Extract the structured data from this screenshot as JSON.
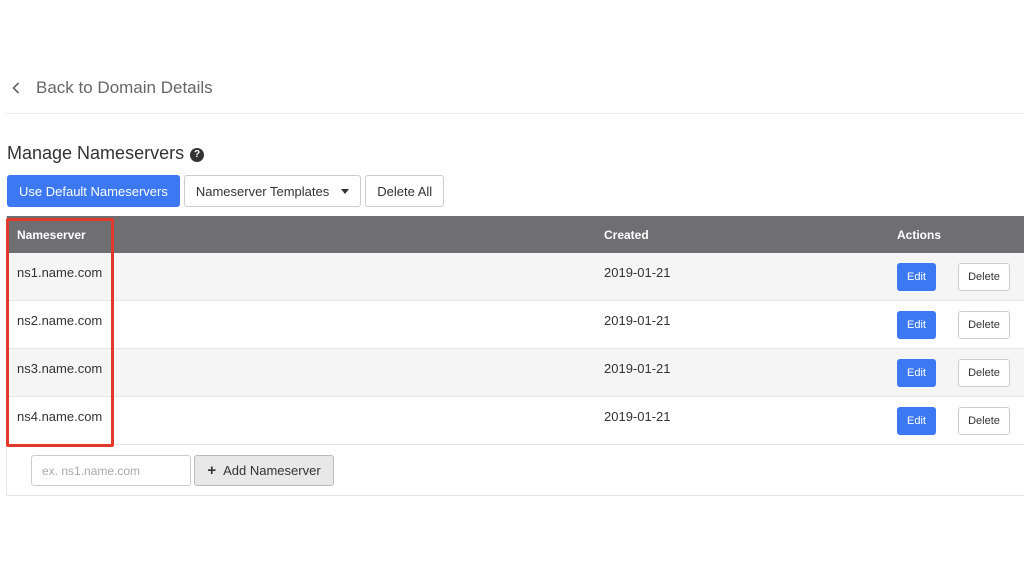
{
  "nav": {
    "back_label": "Back to Domain Details"
  },
  "page": {
    "title": "Manage Nameservers",
    "help_icon": "?"
  },
  "toolbar": {
    "default_label": "Use Default Nameservers",
    "templates_label": "Nameserver Templates",
    "delete_all_label": "Delete All"
  },
  "table": {
    "headers": {
      "nameserver": "Nameserver",
      "created": "Created",
      "actions": "Actions"
    },
    "rows": [
      {
        "nameserver": "ns1.name.com",
        "created": "2019-01-21",
        "edit": "Edit",
        "delete": "Delete"
      },
      {
        "nameserver": "ns2.name.com",
        "created": "2019-01-21",
        "edit": "Edit",
        "delete": "Delete"
      },
      {
        "nameserver": "ns3.name.com",
        "created": "2019-01-21",
        "edit": "Edit",
        "delete": "Delete"
      },
      {
        "nameserver": "ns4.name.com",
        "created": "2019-01-21",
        "edit": "Edit",
        "delete": "Delete"
      }
    ]
  },
  "add": {
    "placeholder": "ex. ns1.name.com",
    "value": "",
    "button_label": "Add Nameserver",
    "button_icon": "+"
  },
  "colors": {
    "primary": "#3b78f2",
    "header_bg": "#6f6f73",
    "highlight": "#e03a2c"
  }
}
